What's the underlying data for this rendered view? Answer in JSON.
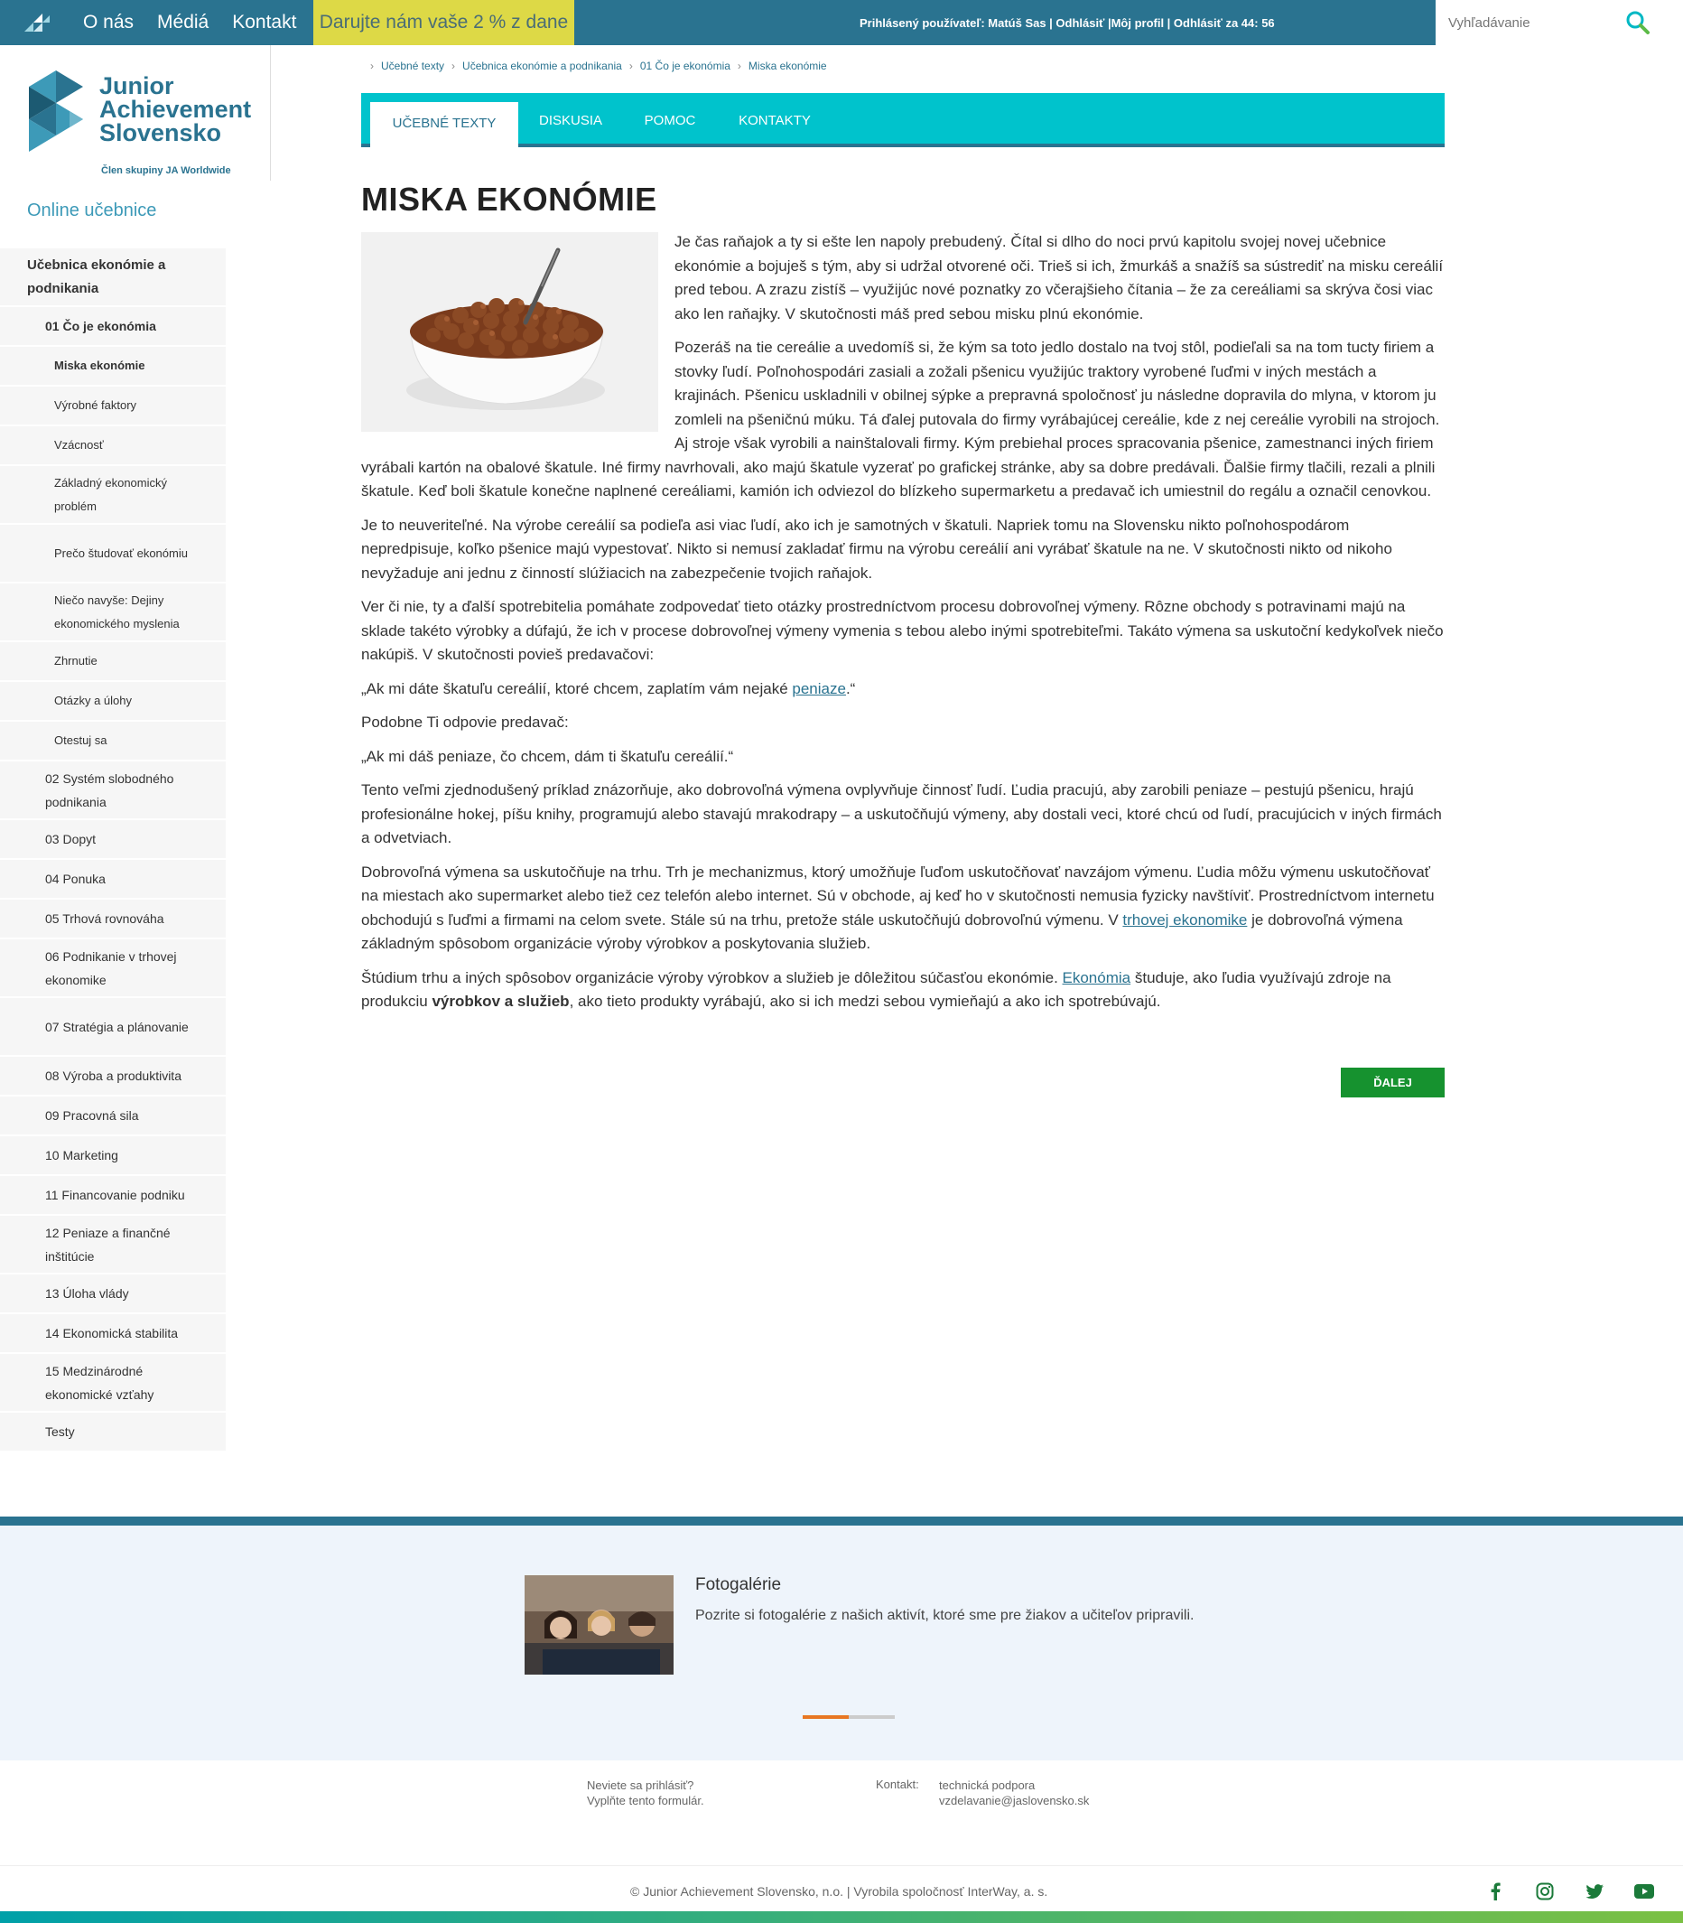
{
  "topbar": {
    "nav": [
      "O nás",
      "Médiá",
      "Kontakt"
    ],
    "donate": "Darujte nám vaše 2 % z dane",
    "userinfo": "Prihlásený používateľ: Matúš Sas | Odhlásiť |Môj profil | Odhlásiť za 44: 56",
    "search_placeholder": "Vyhľadávanie"
  },
  "logo": {
    "line1": "Junior",
    "line2": "Achievement",
    "line3": "Slovensko",
    "sub": "Člen skupiny JA Worldwide"
  },
  "sidebar": {
    "title": "Online učebnice",
    "items": [
      {
        "label": "Učebnica ekonómie a podnikania",
        "level": 0,
        "bold": true
      },
      {
        "label": "01 Čo je ekonómia",
        "level": 1,
        "bold": true
      },
      {
        "label": "Miska ekonómie",
        "level": 2,
        "bold": true
      },
      {
        "label": "Výrobné faktory",
        "level": 2,
        "bold": false
      },
      {
        "label": "Vzácnosť",
        "level": 2,
        "bold": false
      },
      {
        "label": "Základný ekonomický problém",
        "level": 2,
        "bold": false
      },
      {
        "label": "Prečo študovať ekonómiu",
        "level": 2,
        "bold": false
      },
      {
        "label": "Niečo navyše: Dejiny ekonomického myslenia",
        "level": 2,
        "bold": false
      },
      {
        "label": "Zhrnutie",
        "level": 2,
        "bold": false
      },
      {
        "label": "Otázky a úlohy",
        "level": 2,
        "bold": false
      },
      {
        "label": "Otestuj sa",
        "level": 2,
        "bold": false
      },
      {
        "label": "02 Systém slobodného podnikania",
        "level": 1,
        "bold": false
      },
      {
        "label": "03 Dopyt",
        "level": 1,
        "bold": false
      },
      {
        "label": "04 Ponuka",
        "level": 1,
        "bold": false
      },
      {
        "label": "05 Trhová rovnováha",
        "level": 1,
        "bold": false
      },
      {
        "label": "06 Podnikanie v trhovej ekonomike",
        "level": 1,
        "bold": false
      },
      {
        "label": "07 Stratégia a plánovanie",
        "level": 1,
        "bold": false
      },
      {
        "label": "08 Výroba a produktivita",
        "level": 1,
        "bold": false
      },
      {
        "label": "09 Pracovná sila",
        "level": 1,
        "bold": false
      },
      {
        "label": "10 Marketing",
        "level": 1,
        "bold": false
      },
      {
        "label": "11 Financovanie podniku",
        "level": 1,
        "bold": false
      },
      {
        "label": "12 Peniaze a finančné inštitúcie",
        "level": 1,
        "bold": false
      },
      {
        "label": "13 Úloha vlády",
        "level": 1,
        "bold": false
      },
      {
        "label": "14 Ekonomická stabilita",
        "level": 1,
        "bold": false
      },
      {
        "label": "15 Medzinárodné ekonomické vzťahy",
        "level": 1,
        "bold": false
      },
      {
        "label": "Testy",
        "level": 1,
        "bold": false
      }
    ]
  },
  "breadcrumb": [
    "Učebné texty",
    "Učebnica ekonómie a podnikania",
    "01 Čo je ekonómia",
    "Miska ekonómie"
  ],
  "tabs": [
    "UČEBNÉ TEXTY",
    "DISKUSIA",
    "POMOC",
    "KONTAKTY"
  ],
  "article": {
    "title": "MISKA EKONÓMIE",
    "p1": "Je čas raňajok a ty si ešte len napoly prebudený. Čítal si dlho do noci prvú kapitolu svojej novej učebnice ekonómie a bojuješ s tým, aby si udržal otvorené oči. Trieš si ich, žmurkáš a snažíš sa sústrediť na misku cereálií pred tebou. A zrazu zistíš – využijúc nové poznatky zo včerajšieho čítania – že za cereáliami sa skrýva čosi viac ako len raňajky. V skutočnosti máš pred sebou misku plnú ekonómie.",
    "p2": "Pozeráš na tie cereálie a uvedomíš si, že kým sa toto jedlo dostalo na tvoj stôl, podieľali sa na tom tucty firiem a stovky ľudí. Poľnohospodári zasiali a zožali pšenicu využijúc traktory vyrobené ľuďmi v iných mestách a krajinách. Pšenicu uskladnili v obilnej sýpke a prepravná spoločnosť ju následne dopravila do mlyna, v ktorom ju zomleli na pšeničnú múku. Tá ďalej putovala do firmy vyrábajúcej cereálie, kde z nej cereálie vyrobili na strojoch. Aj stroje však vyrobili a nainštalovali firmy. Kým prebiehal proces spracovania pšenice, zamestnanci iných firiem vyrábali kartón na obalové škatule. Iné firmy navrhovali, ako majú škatule vyzerať po grafickej stránke, aby sa dobre predávali. Ďalšie firmy tlačili, rezali a plnili škatule. Keď boli škatule konečne naplnené cereáliami, kamión ich odviezol do blízkeho supermarketu a predavač ich umiestnil do regálu a označil cenovkou.",
    "p3": "Je to neuveriteľné. Na výrobe cereálií sa podieľa asi viac ľudí, ako ich je samotných v škatuli. Napriek tomu na Slovensku nikto poľnohospodárom nepredpisuje, koľko pšenice majú vypestovať. Nikto si nemusí zakladať firmu na výrobu cereálií ani vyrábať škatule na ne. V skutočnosti nikto od nikoho nevyžaduje ani jednu z činností slúžiacich na zabezpečenie tvojich raňajok.",
    "p4": "Ver či nie, ty a ďalší spotrebitelia pomáhate zodpovedať tieto otázky prostredníctvom procesu dobrovoľnej výmeny. Rôzne obchody s potravinami majú na sklade takéto výrobky a dúfajú, že ich v procese dobrovoľnej výmeny vymenia s tebou alebo inými spotrebiteľmi. Takáto výmena sa uskutoční kedykoľvek niečo nakúpiš. V skutočnosti povieš predavačovi:",
    "p5_pre": "„Ak mi dáte škatuľu cereálií, ktoré chcem, zaplatím vám nejaké ",
    "p5_link": "peniaze",
    "p5_post": ".“",
    "p6": "Podobne Ti odpovie predavač:",
    "p7": "„Ak mi dáš peniaze, čo chcem, dám ti škatuľu cereálií.“",
    "p8": "Tento veľmi zjednodušený príklad znázorňuje, ako dobrovoľná výmena ovplyvňuje činnosť ľudí. Ľudia pracujú, aby zarobili peniaze – pestujú pšenicu, hrajú profesionálne hokej, píšu knihy, programujú alebo stavajú mrakodrapy – a uskutočňujú výmeny, aby dostali veci, ktoré chcú od ľudí, pracujúcich v iných firmách a odvetviach.",
    "p9_pre": "Dobrovoľná výmena sa uskutočňuje na trhu. Trh je mechanizmus, ktorý umožňuje ľuďom uskutočňovať navzájom výmenu. Ľudia môžu výmenu uskutočňovať na miestach ako supermarket alebo tiež cez telefón alebo internet. Sú v obchode, aj keď ho v skutočnosti nemusia fyzicky navštíviť. Prostredníctvom internetu obchodujú s ľuďmi a firmami na celom svete. Stále sú na trhu, pretože stále uskutočňujú dobrovoľnú výmenu. V ",
    "p9_link": "trhovej ekonomike",
    "p9_post": " je dobrovoľná výmena základným spôsobom organizácie výroby výrobkov a poskytovania služieb.",
    "p10_pre": "Štúdium trhu a iných spôsobov organizácie výroby výrobkov a služieb je dôležitou súčasťou ekonómie. ",
    "p10_link": "Ekonómia",
    "p10_mid": " študuje, ako ľudia využívajú zdroje na produkciu ",
    "p10_bold": "výrobkov a služieb",
    "p10_post": ", ako tieto produkty vyrábajú, ako si ich medzi sebou vymieňajú a ako ich spotrebúvajú.",
    "next_button": "ĎALEJ"
  },
  "footer": {
    "gallery_title": "Fotogalérie",
    "gallery_desc": "Pozrite si fotogalérie z našich aktivít, ktoré sme pre žiakov a učiteľov pripravili.",
    "slider_progress": 0.5,
    "login_line1": "Neviete sa prihlásiť?",
    "login_line2": "Vyplňte tento formulár.",
    "contact_label": "Kontakt:",
    "contact_line1": "technická podpora",
    "contact_line2": "vzdelavanie@jaslovensko.sk",
    "copyright": "© Junior Achievement Slovensko, n.o. | Vyrobila spoločnosť InterWay, a. s.",
    "social": [
      "facebook-icon",
      "instagram-icon",
      "twitter-icon",
      "youtube-icon",
      "print-icon"
    ]
  },
  "colors": {
    "primary": "#2a7390",
    "accent": "#00c3cc",
    "donate": "#ddd946",
    "button": "#16922f",
    "slider": "#e87722"
  }
}
